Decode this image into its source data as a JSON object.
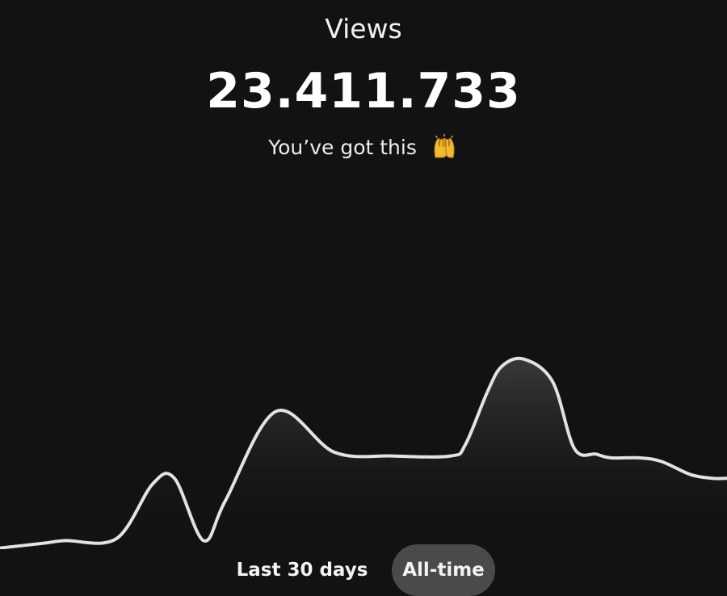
{
  "header": {
    "title": "Views",
    "count": "23.411.733",
    "subtitle": "You’ve got this",
    "subtitle_icon": "raising-hands-icon"
  },
  "range": {
    "options": [
      "Last 30 days",
      "All-time"
    ],
    "selected": "All-time"
  },
  "chart_data": {
    "type": "area",
    "x": [
      0,
      0.06,
      0.09,
      0.16,
      0.21,
      0.24,
      0.28,
      0.31,
      0.38,
      0.46,
      0.54,
      0.62,
      0.64,
      0.67,
      0.69,
      0.72,
      0.76,
      0.79,
      0.82,
      0.84,
      0.88,
      0.91,
      0.95,
      0.98,
      1
    ],
    "values": [
      0.3,
      1.6,
      2.3,
      2.8,
      17.5,
      19,
      2.3,
      13,
      37,
      26,
      25,
      25,
      28,
      42,
      49,
      51,
      45,
      27,
      25.5,
      24.5,
      24.5,
      23.5,
      20,
      19,
      19
    ],
    "ylim": [
      0,
      65
    ],
    "line_color": "#e2e2e2"
  }
}
